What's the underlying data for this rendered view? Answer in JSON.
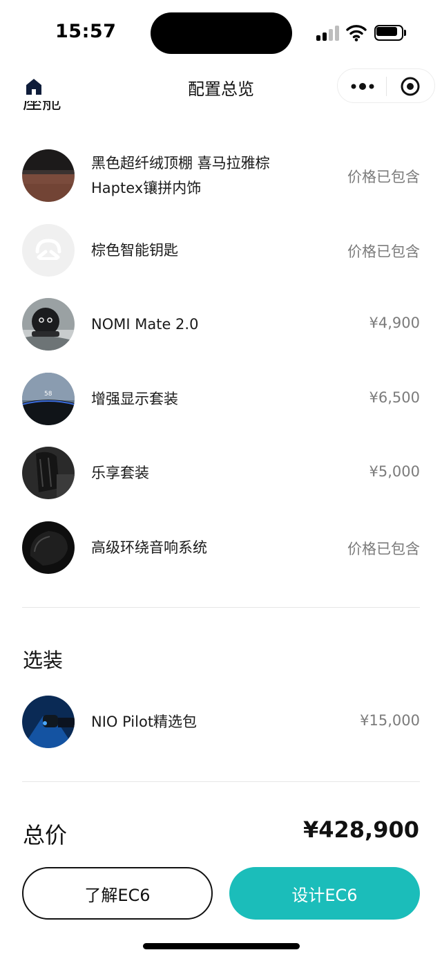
{
  "status_bar": {
    "time": "15:57"
  },
  "nav": {
    "title": "配置总览"
  },
  "cut_heading": "座舱",
  "items": [
    {
      "name_line1": "黑色超纤绒顶棚 喜马拉雅棕",
      "name_line2": "Haptex镶拼内饰",
      "price": "价格已包含",
      "thumb": "interior-leather"
    },
    {
      "name": "棕色智能钥匙",
      "price": "价格已包含",
      "thumb": "nio-logo-key"
    },
    {
      "name": "NOMI Mate 2.0",
      "price": "¥4,900",
      "thumb": "nomi-robot"
    },
    {
      "name": "增强显示套装",
      "price": "¥6,500",
      "thumb": "hud-display",
      "thumb_text": "58"
    },
    {
      "name": "乐享套装",
      "price": "¥5,000",
      "thumb": "seat"
    },
    {
      "name": "高级环绕音响系统",
      "price": "价格已包含",
      "thumb": "speaker"
    }
  ],
  "options_section": {
    "title": "选装",
    "items": [
      {
        "name": "NIO Pilot精选包",
        "price": "¥15,000",
        "thumb": "nio-pilot"
      }
    ]
  },
  "total": {
    "label": "总价",
    "value": "¥428,900"
  },
  "buttons": {
    "learn": "了解EC6",
    "design": "设计EC6"
  },
  "colors": {
    "accent": "#1bbdba",
    "text": "#111111",
    "muted": "#7b7b7b"
  }
}
